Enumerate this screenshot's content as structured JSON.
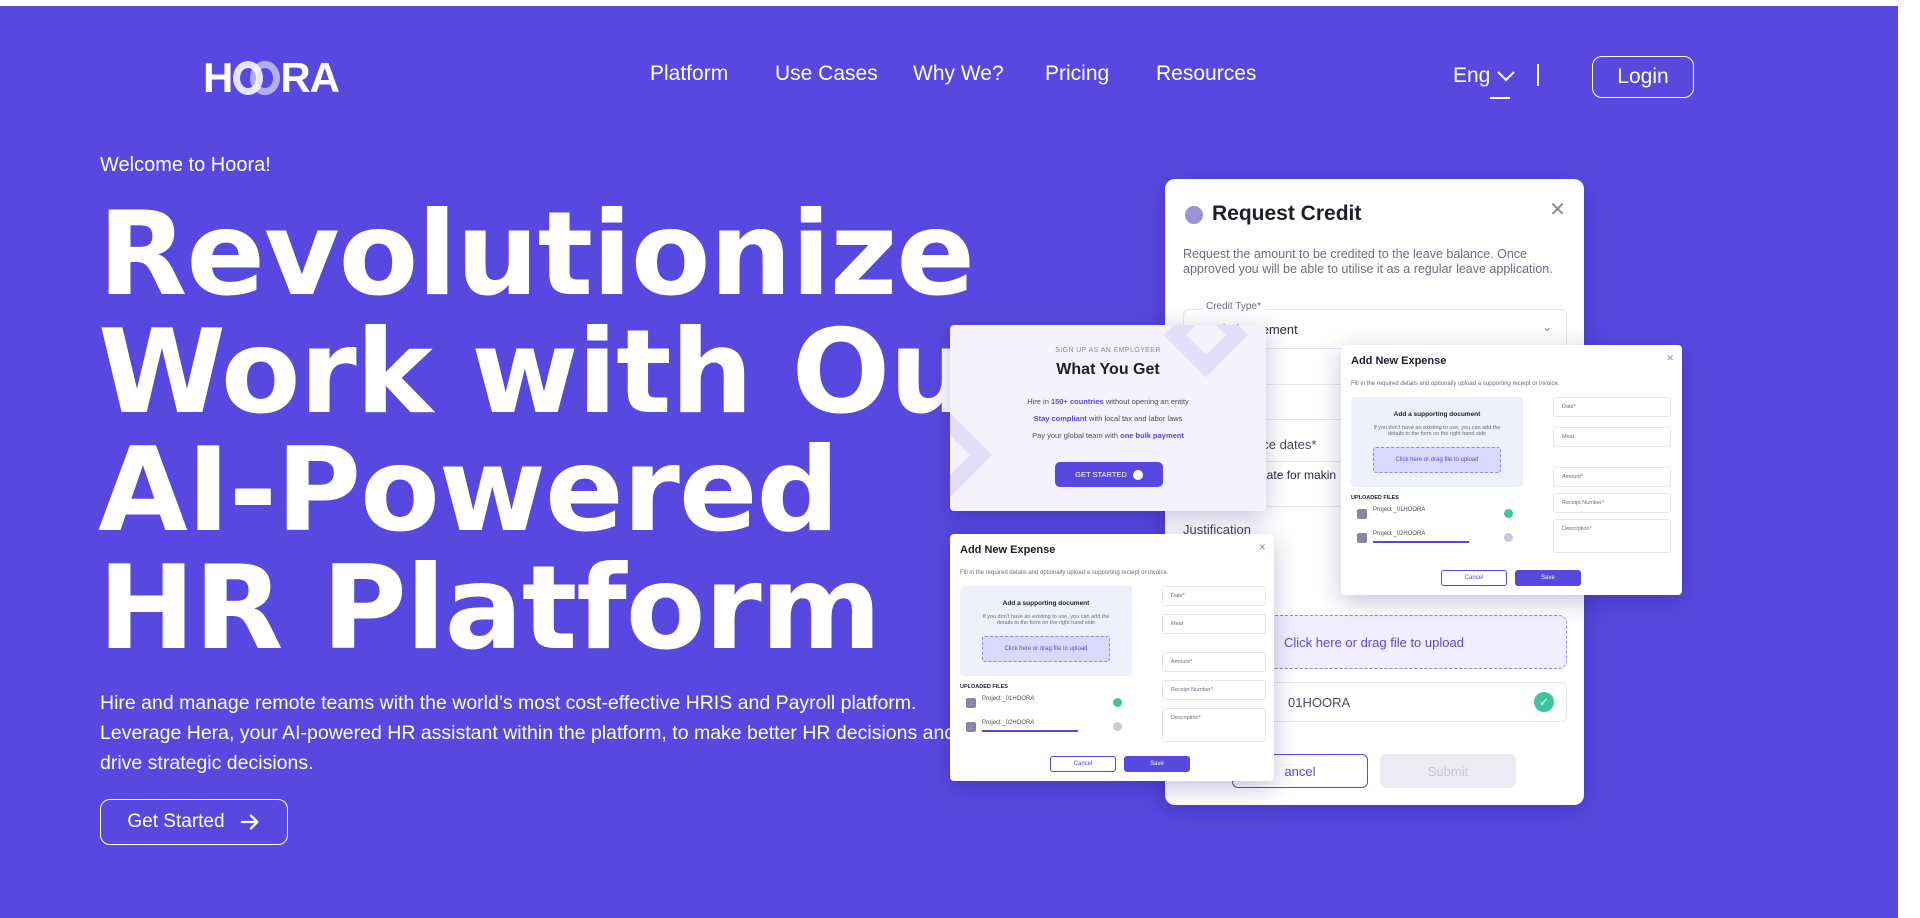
{
  "nav": {
    "logo": {
      "h": "H",
      "ra": "RA",
      "full": "HOORA"
    },
    "links": [
      "Platform",
      "Use Cases",
      "Why We?",
      "Pricing",
      "Resources"
    ],
    "language": "Eng",
    "login": "Login"
  },
  "hero": {
    "welcome": "Welcome to Hoora!",
    "headline": [
      "Revolutionize",
      "Work with Our",
      "AI-Powered",
      "HR Platform"
    ],
    "description": "Hire and manage remote teams with the world’s most cost-effective HRIS and Payroll platform. Leverage Hera, your AI-powered HR assistant within the platform, to make better HR decisions and drive strategic decisions.",
    "cta": "Get Started"
  },
  "request_credit": {
    "title": "Request Credit",
    "subtitle": "Request the amount to be credited to the leave balance. Once approved you will be able to utilise it as a regular leave application.",
    "credit_type_label": "Credit Type*",
    "credit_type_value": "Reimbursement",
    "dates_label": "nce dates*",
    "dates_hint": "e date for makin",
    "dates_hint2": "s",
    "justification_label": "Justification",
    "upload_text": "Click here or drag file to upload",
    "file_name": "01HOORA",
    "cancel": "ancel",
    "submit": "Submit"
  },
  "what_you_get": {
    "eyebrow": "SIGN UP AS AN EMPLOYEER",
    "title": "What You Get",
    "line1_pre": "Hire in",
    "line1_bold": "150+ countries",
    "line1_post": "without opening an entity",
    "line2_bold": "Stay compliant",
    "line2_post": "with local tax and labor laws",
    "line3_pre": "Pay your global team with",
    "line3_bold": "one bulk payment",
    "cta": "GET STARTED"
  },
  "expense": {
    "title": "Add New Expense",
    "subtitle": "Fill in the required details and optionally upload a supporting receipt or invoice.",
    "upload_title": "Add a supporting document",
    "upload_desc": "If you don’t have an existing to use, you can add the details to the form on the right hand side",
    "upload_btn": "Click here or drag file to upload",
    "uploaded": "UPLOADED FILES",
    "file1": "Project _01HOORA",
    "file2": "Project _02HOORA",
    "date": "Date*",
    "meal": "Meal",
    "amount": "Amount*",
    "receipt": "Receipt Number*",
    "description": "Description*",
    "cancel": "Cancel",
    "save": "Save"
  },
  "colors": {
    "brand": "#5749e0",
    "success": "#3fc59d"
  }
}
